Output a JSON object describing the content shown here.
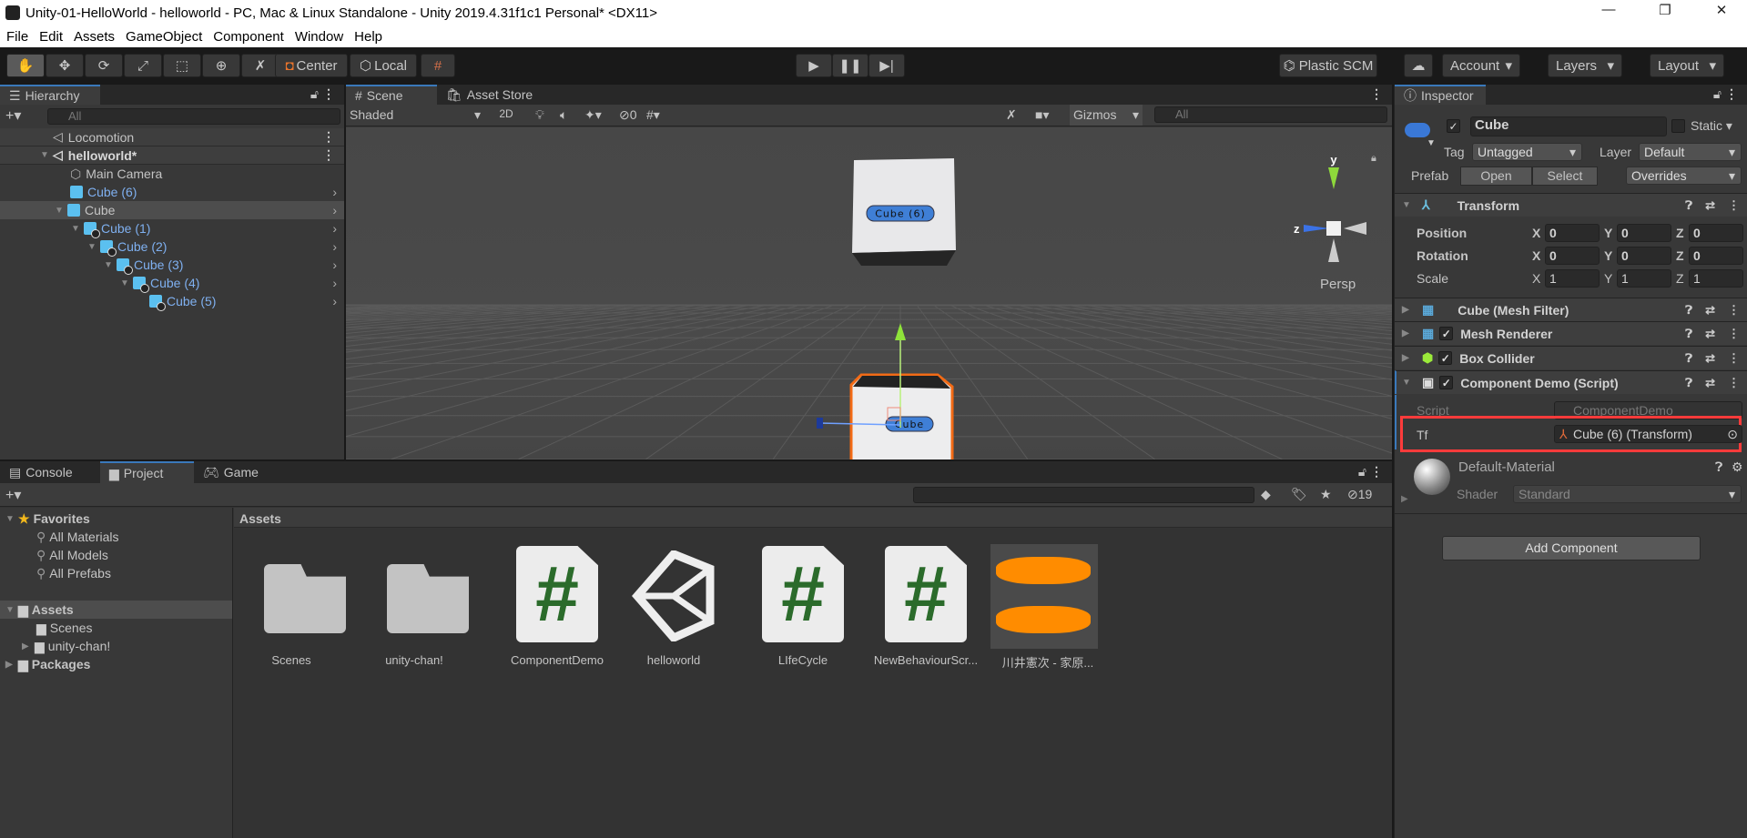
{
  "window": {
    "title": "Unity-01-HelloWorld - helloworld - PC, Mac & Linux Standalone - Unity 2019.4.31f1c1 Personal* <DX11>",
    "minimize": "—",
    "maximize": "❐",
    "close": "✕"
  },
  "menu": [
    "File",
    "Edit",
    "Assets",
    "GameObject",
    "Component",
    "Window",
    "Help"
  ],
  "toolbar": {
    "tools": [
      "hand-tool",
      "move-tool",
      "rotate-tool",
      "scale-tool",
      "rect-tool",
      "transform-tool",
      "custom-tool"
    ],
    "pivot": "Center",
    "space": "Local",
    "plastic": "Plastic SCM",
    "account": "Account",
    "layers": "Layers",
    "layout": "Layout"
  },
  "hierarchy": {
    "tab": "Hierarchy",
    "search_placeholder": "All",
    "items": [
      {
        "label": "Locomotion",
        "type": "scene"
      },
      {
        "label": "helloworld*",
        "type": "scene"
      },
      {
        "label": "Main Camera",
        "type": "object"
      },
      {
        "label": "Cube (6)",
        "type": "prefab"
      },
      {
        "label": "Cube",
        "type": "prefab",
        "selected": true
      },
      {
        "label": "Cube (1)",
        "type": "prefab-child"
      },
      {
        "label": "Cube (2)",
        "type": "prefab-child"
      },
      {
        "label": "Cube (3)",
        "type": "prefab-child"
      },
      {
        "label": "Cube (4)",
        "type": "prefab-child"
      },
      {
        "label": "Cube (5)",
        "type": "prefab-child"
      }
    ]
  },
  "scene": {
    "tabs": [
      "Scene",
      "Asset Store"
    ],
    "shading": "Shaded",
    "mode_2d": "2D",
    "hidden_count": "0",
    "gizmos": "Gizmos",
    "search_placeholder": "All",
    "persp": "Persp",
    "axis_y": "y",
    "axis_z": "z",
    "labels": {
      "top_cube": "Cube (6)",
      "selected_cube": "Cube"
    }
  },
  "bottom": {
    "tabs": [
      "Console",
      "Project",
      "Game"
    ],
    "hidden_count": "19",
    "favorites": {
      "label": "Favorites",
      "items": [
        "All Materials",
        "All Models",
        "All Prefabs"
      ]
    },
    "tree": {
      "assets": "Assets",
      "children": [
        "Scenes",
        "unity-chan!"
      ],
      "packages": "Packages"
    },
    "breadcrumb": "Assets",
    "assets": [
      {
        "name": "Scenes",
        "kind": "folder"
      },
      {
        "name": "unity-chan!",
        "kind": "folder"
      },
      {
        "name": "ComponentDemo",
        "kind": "script"
      },
      {
        "name": "helloworld",
        "kind": "scene"
      },
      {
        "name": "LIfeCycle",
        "kind": "script"
      },
      {
        "name": "NewBehaviourScr...",
        "kind": "script"
      },
      {
        "name": "川井憲次 - 家原...",
        "kind": "audio"
      }
    ]
  },
  "inspector": {
    "tab": "Inspector",
    "name": "Cube",
    "active": true,
    "static": "Static",
    "tag_label": "Tag",
    "tag": "Untagged",
    "layer_label": "Layer",
    "layer": "Default",
    "prefab_label": "Prefab",
    "open": "Open",
    "select": "Select",
    "overrides": "Overrides",
    "transform": {
      "title": "Transform",
      "position": {
        "label": "Position",
        "x": "0",
        "y": "0",
        "z": "0"
      },
      "rotation": {
        "label": "Rotation",
        "x": "0",
        "y": "0",
        "z": "0"
      },
      "scale": {
        "label": "Scale",
        "x": "1",
        "y": "1",
        "z": "1"
      }
    },
    "components": [
      "Cube (Mesh Filter)",
      "Mesh Renderer",
      "Box Collider",
      "Component Demo (Script)"
    ],
    "script_label": "Script",
    "script_value": "ComponentDemo",
    "tf_label": "Tf",
    "tf_value": "Cube (6) (Transform)",
    "material": "Default-Material",
    "shader_label": "Shader",
    "shader": "Standard",
    "add_component": "Add Component",
    "highlight_color": "#ff3b3b"
  }
}
